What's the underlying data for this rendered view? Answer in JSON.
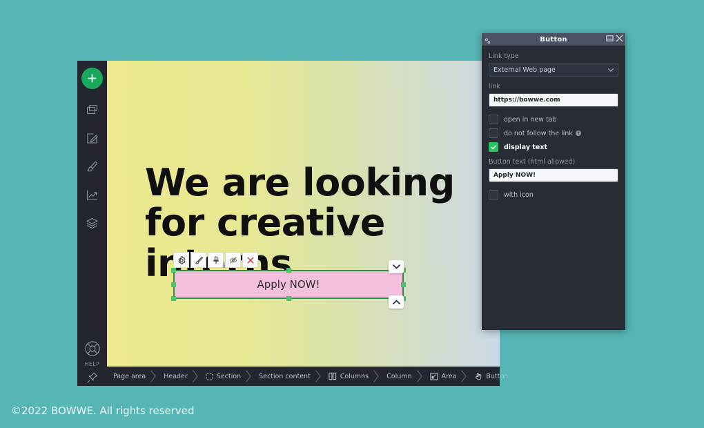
{
  "page": {
    "background_color": "#56b5b5",
    "footer_text": "©2022 BOWWE. All rights reserved"
  },
  "sidebar": {
    "add_label": "add",
    "items": [
      {
        "name": "pages-icon",
        "label": "Pages"
      },
      {
        "name": "edit-icon",
        "label": "Edit"
      },
      {
        "name": "brush-icon",
        "label": "Design"
      },
      {
        "name": "analytics-icon",
        "label": "Analytics"
      },
      {
        "name": "layers-icon",
        "label": "Layers"
      }
    ],
    "help_label": "HELP",
    "pin_label": "pin"
  },
  "canvas": {
    "headline": "We are looking for creative interns",
    "gradient_from": "#ece98f",
    "gradient_to": "#ccd8e8"
  },
  "mini_toolbar": {
    "buttons": [
      {
        "name": "settings-icon",
        "label": "Settings"
      },
      {
        "name": "brush-icon",
        "label": "Style"
      },
      {
        "name": "pin-icon",
        "label": "Pin"
      },
      {
        "name": "eye-off-icon",
        "label": "Hide"
      },
      {
        "name": "close-icon",
        "label": "Delete"
      }
    ]
  },
  "selection": {
    "button_text": "Apply NOW!",
    "button_color": "#f4bedd",
    "handle_color": "#4cc46a",
    "move_down_label": "move down",
    "move_up_label": "move up"
  },
  "breadcrumb": {
    "items": [
      {
        "label": "Page area",
        "icon": ""
      },
      {
        "label": "Header",
        "icon": ""
      },
      {
        "label": "Section",
        "icon": "section-icon"
      },
      {
        "label": "Section content",
        "icon": ""
      },
      {
        "label": "Columns",
        "icon": "columns-icon"
      },
      {
        "label": "Column",
        "icon": ""
      },
      {
        "label": "Area",
        "icon": "area-icon"
      },
      {
        "label": "Button",
        "icon": "button-hand-icon"
      }
    ]
  },
  "panel": {
    "title": "Button",
    "minimize_label": "minimize",
    "close_label": "close",
    "link_type_label": "Link type",
    "link_type_value": "External Web page",
    "link_label": "link",
    "link_value": "https://bowwe.com",
    "open_new_tab_label": "open in new tab",
    "open_new_tab_checked": false,
    "nofollow_label": "do not follow the link",
    "nofollow_checked": false,
    "nofollow_help": "?",
    "display_text_label": "display text",
    "display_text_checked": true,
    "button_text_label": "Button text (html allowed)",
    "button_text_value": "Apply NOW!",
    "with_icon_label": "with icon",
    "with_icon_checked": false,
    "accent_color": "#27c460"
  }
}
